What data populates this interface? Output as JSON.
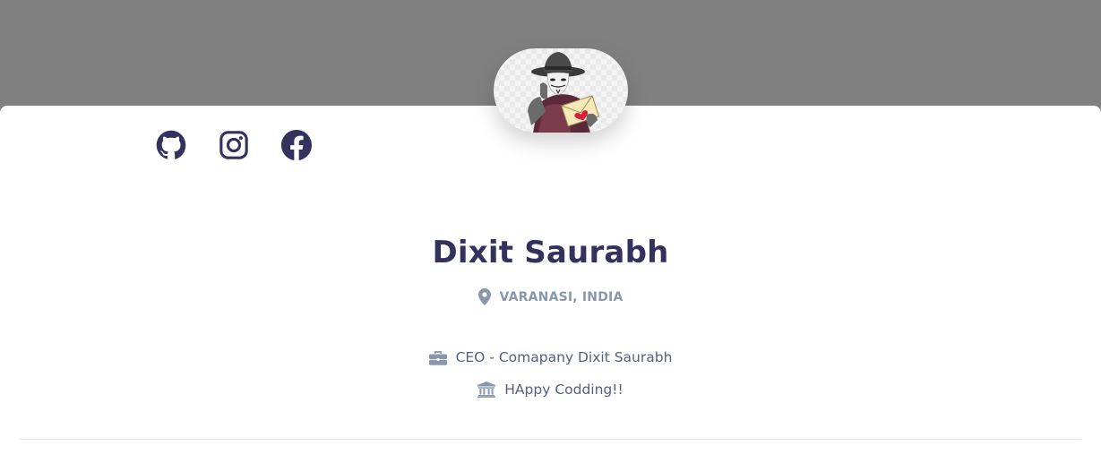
{
  "profile": {
    "name": "Dixit Saurabh",
    "location": "VARANASI, INDIA",
    "position": "CEO - Comapany Dixit Saurabh",
    "education": "HAppy Codding!!"
  },
  "social_links": [
    {
      "name": "github",
      "icon": "github-icon"
    },
    {
      "name": "instagram",
      "icon": "instagram-icon"
    },
    {
      "name": "facebook",
      "icon": "facebook-icon"
    }
  ],
  "icons": {
    "location": "map-marker-icon",
    "position": "briefcase-icon",
    "education": "university-icon"
  },
  "colors": {
    "header_band": "#808080",
    "card": "#ffffff",
    "heading": "#32325d",
    "muted": "#8898aa",
    "body_text": "#525f7f",
    "divider": "#e9ecef"
  }
}
